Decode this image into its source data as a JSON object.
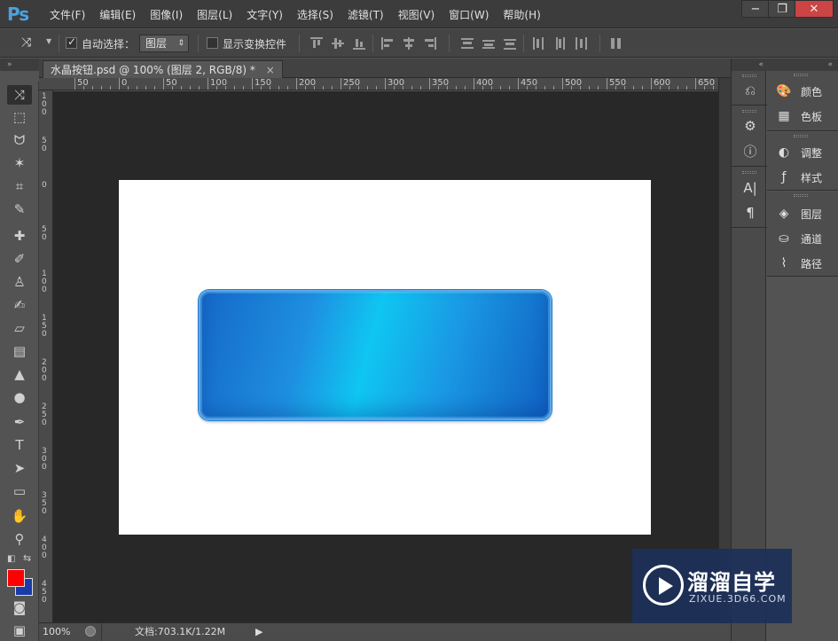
{
  "app": {
    "logo": "Ps"
  },
  "menu": [
    "文件(F)",
    "编辑(E)",
    "图像(I)",
    "图层(L)",
    "文字(Y)",
    "选择(S)",
    "滤镜(T)",
    "视图(V)",
    "窗口(W)",
    "帮助(H)"
  ],
  "window_controls": {
    "minimize": "−",
    "restore": "❐",
    "close": "✕"
  },
  "options_bar": {
    "auto_select_label": "自动选择：",
    "auto_select_checked": true,
    "auto_select_value": "图层",
    "transform_controls_label": "显示变换控件",
    "transform_controls_checked": false
  },
  "document_tab": {
    "title": "水晶按钮.psd @ 100% (图层 2, RGB/8) *",
    "close": "×"
  },
  "ruler_h_labels": [
    "50",
    "0",
    "50",
    "100",
    "150",
    "200",
    "250",
    "300",
    "350",
    "400",
    "450",
    "500",
    "550",
    "600",
    "650"
  ],
  "ruler_v_labels": [
    "100",
    "50",
    "0",
    "50",
    "100",
    "150",
    "200",
    "250",
    "300",
    "350",
    "400",
    "450",
    "500"
  ],
  "status": {
    "zoom": "100%",
    "doc_info": "文档:703.1K/1.22M",
    "arrow": "▶"
  },
  "right_dock": {
    "groups": [
      [
        {
          "icon": "palette-icon",
          "label": "颜色"
        },
        {
          "icon": "swatches-icon",
          "label": "色板"
        }
      ],
      [
        {
          "icon": "adjustments-icon",
          "label": "调整"
        },
        {
          "icon": "styles-icon",
          "label": "样式"
        }
      ],
      [
        {
          "icon": "layers-icon",
          "label": "图层"
        },
        {
          "icon": "channels-icon",
          "label": "通道"
        },
        {
          "icon": "paths-icon",
          "label": "路径"
        }
      ]
    ]
  },
  "foreground_color": "#ff0000",
  "background_color": "#1a3aa8",
  "watermark": {
    "title": "溜溜自学",
    "url": "ZIXUE.3D66.COM"
  }
}
